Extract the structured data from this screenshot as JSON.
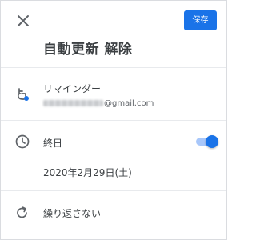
{
  "header": {
    "close_icon": "close-icon",
    "save_label": "保存",
    "title": "自動更新 解除"
  },
  "reminder": {
    "icon": "reminder-hand-icon",
    "label": "リマインダー",
    "email_suffix": "@gmail.com"
  },
  "all_day": {
    "icon": "clock-icon",
    "label": "終日",
    "toggle_on": true,
    "date": "2020年2月29日(土)"
  },
  "repeat": {
    "icon": "repeat-icon",
    "label": "繰り返さない"
  },
  "colors": {
    "accent": "#1a73e8",
    "toggle_track": "#a8c7fa",
    "text": "#3c4043",
    "divider": "#e8eaed"
  }
}
